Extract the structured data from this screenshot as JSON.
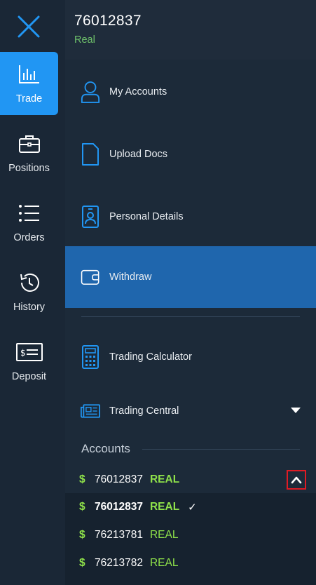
{
  "rail": {
    "close_icon": "close-icon",
    "items": [
      {
        "label": "Trade",
        "icon": "chart-bars-icon",
        "active": true
      },
      {
        "label": "Positions",
        "icon": "briefcase-icon",
        "active": false
      },
      {
        "label": "Orders",
        "icon": "list-icon",
        "active": false
      },
      {
        "label": "History",
        "icon": "history-icon",
        "active": false
      },
      {
        "label": "Deposit",
        "icon": "cheque-icon",
        "active": false
      }
    ]
  },
  "header": {
    "account_number": "76012837",
    "account_type": "Real"
  },
  "menu": {
    "items": [
      {
        "label": "My Accounts",
        "icon": "user-icon"
      },
      {
        "label": "Upload Docs",
        "icon": "document-icon"
      },
      {
        "label": "Personal Details",
        "icon": "id-badge-icon"
      },
      {
        "label": "Withdraw",
        "icon": "wallet-icon",
        "selected": true
      },
      {
        "label": "Trading Calculator",
        "icon": "calculator-icon"
      },
      {
        "label": "Trading Central",
        "icon": "newspaper-icon",
        "has_dropdown": true
      }
    ]
  },
  "accounts": {
    "heading": "Accounts",
    "currency_symbol": "$",
    "summary": {
      "number": "76012837",
      "type": "REAL"
    },
    "list": [
      {
        "number": "76012837",
        "type": "REAL",
        "current": true,
        "check": "✓"
      },
      {
        "number": "76213781",
        "type": "REAL",
        "current": false
      },
      {
        "number": "76213782",
        "type": "REAL",
        "current": false
      }
    ]
  },
  "colors": {
    "accent_blue": "#2196f3",
    "selected_row": "#1f66ad",
    "real_green": "#6fc26b",
    "tag_green": "#8fe24a",
    "highlight_red": "#e01b24"
  }
}
